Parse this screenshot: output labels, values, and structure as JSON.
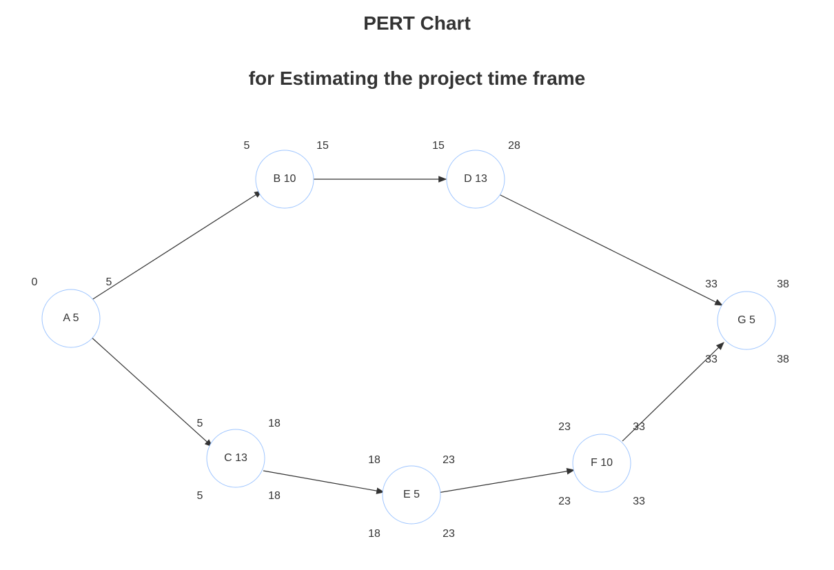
{
  "title": {
    "line1": "PERT Chart",
    "line2": "for Estimating the project time frame"
  },
  "nodes": {
    "A": {
      "label": "A 5",
      "tl": "0",
      "tr": "5",
      "bl": "",
      "br": ""
    },
    "B": {
      "label": "B 10",
      "tl": "5",
      "tr": "15",
      "bl": "",
      "br": ""
    },
    "C": {
      "label": "C 13",
      "tl": "5",
      "tr": "18",
      "bl": "5",
      "br": "18"
    },
    "D": {
      "label": "D 13",
      "tl": "15",
      "tr": "28",
      "bl": "",
      "br": ""
    },
    "E": {
      "label": "E 5",
      "tl": "18",
      "tr": "23",
      "bl": "18",
      "br": "23"
    },
    "F": {
      "label": "F 10",
      "tl": "23",
      "tr": "33",
      "bl": "23",
      "br": "33"
    },
    "G": {
      "label": "G 5",
      "tl": "33",
      "tr": "38",
      "bl": "33",
      "br": "38"
    }
  },
  "chart_data": {
    "type": "network-pert",
    "title": "PERT Chart for Estimating the project time frame",
    "activities": [
      {
        "id": "A",
        "duration": 5,
        "ES": 0,
        "EF": 5
      },
      {
        "id": "B",
        "duration": 10,
        "ES": 5,
        "EF": 15
      },
      {
        "id": "C",
        "duration": 13,
        "ES": 5,
        "EF": 18,
        "LS": 5,
        "LF": 18
      },
      {
        "id": "D",
        "duration": 13,
        "ES": 15,
        "EF": 28
      },
      {
        "id": "E",
        "duration": 5,
        "ES": 18,
        "EF": 23,
        "LS": 18,
        "LF": 23
      },
      {
        "id": "F",
        "duration": 10,
        "ES": 23,
        "EF": 33,
        "LS": 23,
        "LF": 33
      },
      {
        "id": "G",
        "duration": 5,
        "ES": 33,
        "EF": 38,
        "LS": 33,
        "LF": 38
      }
    ],
    "edges": [
      [
        "A",
        "B"
      ],
      [
        "A",
        "C"
      ],
      [
        "B",
        "D"
      ],
      [
        "C",
        "E"
      ],
      [
        "E",
        "F"
      ],
      [
        "D",
        "G"
      ],
      [
        "F",
        "G"
      ]
    ]
  }
}
